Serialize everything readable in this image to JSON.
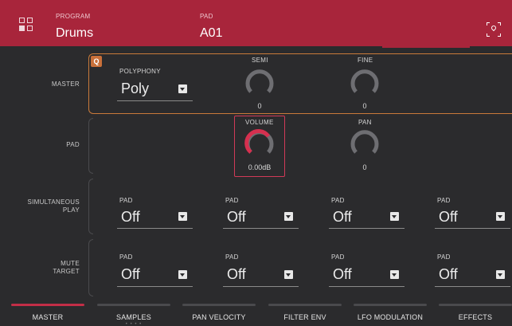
{
  "header": {
    "program_label": "PROGRAM",
    "program_value": "Drums",
    "pad_label": "PAD",
    "pad_value": "A01"
  },
  "rows": {
    "master": "MASTER",
    "pad": "PAD",
    "simultaneous_play": [
      "SIMULTANEOUS",
      "PLAY"
    ],
    "mute_target": [
      "MUTE",
      "TARGET"
    ]
  },
  "master": {
    "q_badge": "Q",
    "polyphony_label": "POLYPHONY",
    "polyphony_value": "Poly",
    "semi_label": "SEMI",
    "semi_value": "0",
    "fine_label": "FINE",
    "fine_value": "0"
  },
  "pad": {
    "volume_label": "VOLUME",
    "volume_value": "0.00dB",
    "pan_label": "PAN",
    "pan_value": "0"
  },
  "simultaneous_play": [
    {
      "label": "PAD",
      "value": "Off"
    },
    {
      "label": "PAD",
      "value": "Off"
    },
    {
      "label": "PAD",
      "value": "Off"
    },
    {
      "label": "PAD",
      "value": "Off"
    }
  ],
  "mute_target": [
    {
      "label": "PAD",
      "value": "Off"
    },
    {
      "label": "PAD",
      "value": "Off"
    },
    {
      "label": "PAD",
      "value": "Off"
    },
    {
      "label": "PAD",
      "value": "Off"
    }
  ],
  "tabs": [
    {
      "label": "MASTER"
    },
    {
      "label": "SAMPLES",
      "dots": "• • • •"
    },
    {
      "label": "PAN VELOCITY"
    },
    {
      "label": "FILTER ENV"
    },
    {
      "label": "LFO MODULATION"
    },
    {
      "label": "EFFECTS"
    }
  ],
  "colors": {
    "accent": "#a8253b",
    "active_tab": "#c22e47",
    "q_border": "#c97a3a",
    "background": "#2b2b2d"
  }
}
